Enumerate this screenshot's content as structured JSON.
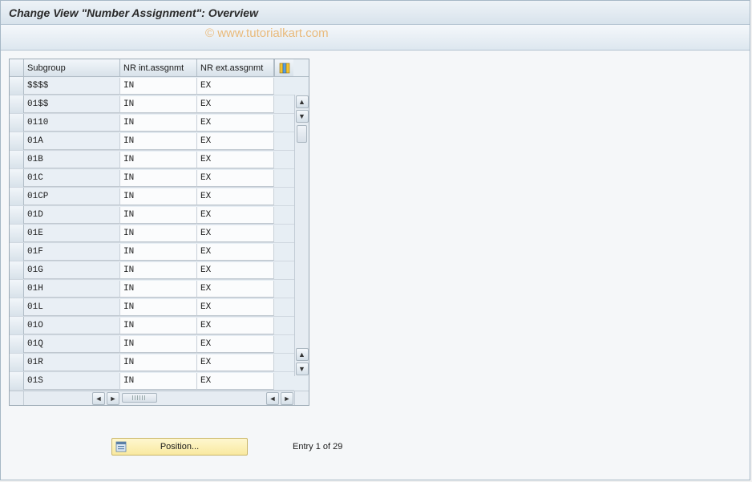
{
  "title": "Change View \"Number Assignment\": Overview",
  "watermark": "© www.tutorialkart.com",
  "columns": {
    "subgroup": "Subgroup",
    "nr_int": "NR int.assgnmt",
    "nr_ext": "NR ext.assgnmt"
  },
  "rows": [
    {
      "subgroup": "$$$$",
      "nr_int": "IN",
      "nr_ext": "EX"
    },
    {
      "subgroup": "01$$",
      "nr_int": "IN",
      "nr_ext": "EX"
    },
    {
      "subgroup": "0110",
      "nr_int": "IN",
      "nr_ext": "EX"
    },
    {
      "subgroup": "01A",
      "nr_int": "IN",
      "nr_ext": "EX"
    },
    {
      "subgroup": "01B",
      "nr_int": "IN",
      "nr_ext": "EX"
    },
    {
      "subgroup": "01C",
      "nr_int": "IN",
      "nr_ext": "EX"
    },
    {
      "subgroup": "01CP",
      "nr_int": "IN",
      "nr_ext": "EX"
    },
    {
      "subgroup": "01D",
      "nr_int": "IN",
      "nr_ext": "EX"
    },
    {
      "subgroup": "01E",
      "nr_int": "IN",
      "nr_ext": "EX"
    },
    {
      "subgroup": "01F",
      "nr_int": "IN",
      "nr_ext": "EX"
    },
    {
      "subgroup": "01G",
      "nr_int": "IN",
      "nr_ext": "EX"
    },
    {
      "subgroup": "01H",
      "nr_int": "IN",
      "nr_ext": "EX"
    },
    {
      "subgroup": "01L",
      "nr_int": "IN",
      "nr_ext": "EX"
    },
    {
      "subgroup": "01O",
      "nr_int": "IN",
      "nr_ext": "EX"
    },
    {
      "subgroup": "01Q",
      "nr_int": "IN",
      "nr_ext": "EX"
    },
    {
      "subgroup": "01R",
      "nr_int": "IN",
      "nr_ext": "EX"
    },
    {
      "subgroup": "01S",
      "nr_int": "IN",
      "nr_ext": "EX"
    }
  ],
  "footer": {
    "position_button": "Position...",
    "entry_info": "Entry 1 of 29"
  },
  "icons": {
    "config": "table-settings-icon",
    "position": "position-icon"
  }
}
